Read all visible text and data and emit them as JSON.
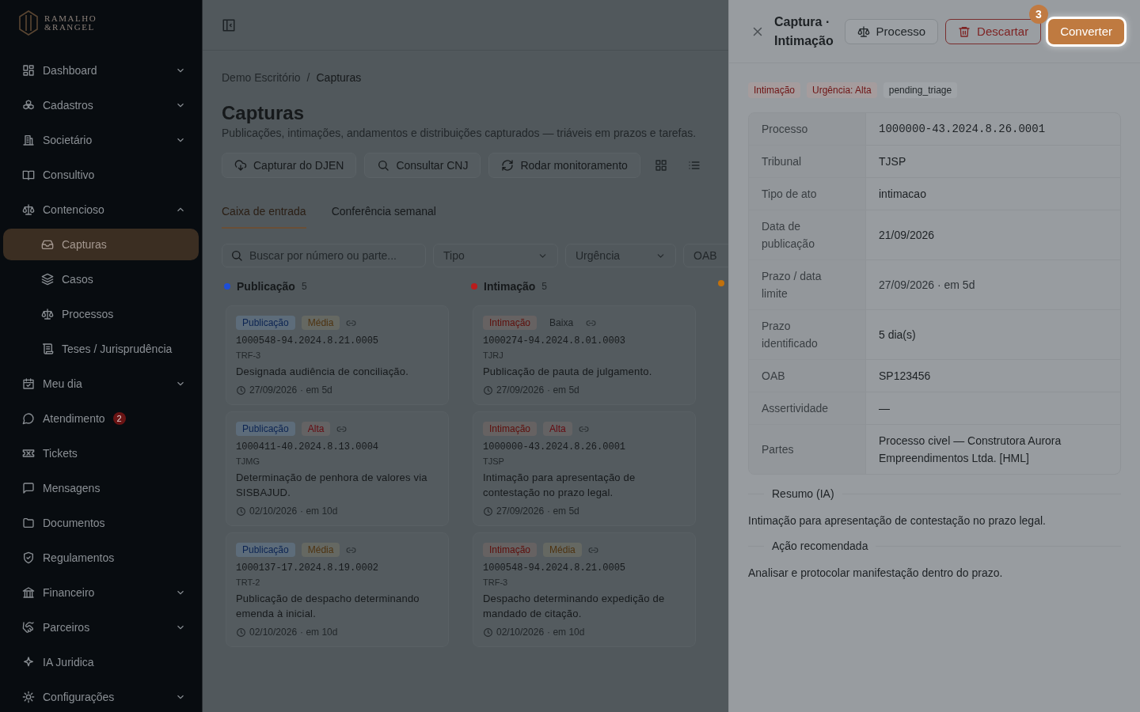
{
  "sidebar": {
    "logo": {
      "line1": "RAMALHO",
      "line2": "&RANGEL"
    },
    "items": [
      {
        "label": "Dashboard",
        "kind": "group",
        "expanded": false,
        "selected": false
      },
      {
        "label": "Cadastros",
        "kind": "group",
        "expanded": false,
        "selected": false
      },
      {
        "label": "Societário",
        "kind": "group",
        "expanded": false,
        "selected": false
      },
      {
        "label": "Consultivo",
        "kind": "link",
        "selected": false
      },
      {
        "label": "Contencioso",
        "kind": "group",
        "expanded": true,
        "selected": false,
        "children": [
          {
            "label": "Capturas",
            "selected": true
          },
          {
            "label": "Casos",
            "selected": false
          },
          {
            "label": "Processos",
            "selected": false
          },
          {
            "label": "Teses / Jurisprudência",
            "selected": false
          }
        ]
      },
      {
        "label": "Meu dia",
        "kind": "group",
        "expanded": false,
        "selected": false
      },
      {
        "label": "Atendimento",
        "kind": "link",
        "selected": false,
        "badge": "2"
      },
      {
        "label": "Tickets",
        "kind": "link",
        "selected": false
      },
      {
        "label": "Mensagens",
        "kind": "link",
        "selected": false
      },
      {
        "label": "Documentos",
        "kind": "link",
        "selected": false
      },
      {
        "label": "Regulamentos",
        "kind": "link",
        "selected": false
      },
      {
        "label": "Financeiro",
        "kind": "group",
        "expanded": false,
        "selected": false
      },
      {
        "label": "Parceiros",
        "kind": "group",
        "expanded": false,
        "selected": false
      },
      {
        "label": "IA Juridica",
        "kind": "link",
        "selected": false
      },
      {
        "label": "Configurações",
        "kind": "group",
        "expanded": false,
        "selected": false
      }
    ]
  },
  "main": {
    "breadcrumb": [
      "Demo Escritório",
      "Capturas"
    ],
    "breadcrumb_separator": "/",
    "title": "Capturas",
    "subtitle": "Publicações, intimações, andamentos e distribuições capturados — triáveis em prazos e tarefas.",
    "actions": [
      "Capturar do DJEN",
      "Consultar CNJ",
      "Rodar monitoramento"
    ],
    "views": [
      {
        "kind": "grid"
      },
      {
        "kind": "list"
      }
    ],
    "tabs": [
      {
        "label": "Caixa de entrada",
        "selected": true
      },
      {
        "label": "Conferência semanal",
        "selected": false
      }
    ],
    "filters": {
      "search": {
        "placeholder": "Buscar por número ou parte..."
      },
      "selects": [
        {
          "placeholder": "Tipo"
        },
        {
          "placeholder": "Urgência"
        },
        {
          "placeholder": "OAB"
        }
      ]
    },
    "columns": [
      {
        "title": "Publicação",
        "count": "5",
        "color": "#1d4ed8",
        "cards": [
          {
            "type": {
              "label": "Publicação",
              "kind": "publication"
            },
            "urgency": {
              "label": "Média",
              "kind": "medium"
            },
            "number": "1000548-94.2024.8.21.0005",
            "court": "TRF-3",
            "text": "Designada audiência de conciliação.",
            "due": "27/09/2026",
            "due_rel": "· em 5d"
          },
          {
            "type": {
              "label": "Publicação",
              "kind": "publication"
            },
            "urgency": {
              "label": "Alta",
              "kind": "high"
            },
            "number": "1000411-40.2024.8.13.0004",
            "court": "TJMG",
            "text": "Determinação de penhora de valores via SISBAJUD.",
            "due": "02/10/2026",
            "due_rel": "· em 10d"
          },
          {
            "type": {
              "label": "Publicação",
              "kind": "publication"
            },
            "urgency": {
              "label": "Média",
              "kind": "medium"
            },
            "number": "1000137-17.2024.8.19.0002",
            "court": "TRT-2",
            "text": "Publicação de despacho determinando emenda à inicial.",
            "due": "02/10/2026",
            "due_rel": "· em 10d"
          }
        ]
      },
      {
        "title": "Intimação",
        "count": "5",
        "color": "#b91c1c",
        "cards": [
          {
            "type": {
              "label": "Intimação",
              "kind": "notice"
            },
            "urgency": {
              "label": "Baixa",
              "kind": "low"
            },
            "number": "1000274-94.2024.8.01.0003",
            "court": "TJRJ",
            "text": "Publicação de pauta de julgamento.",
            "due": "27/09/2026",
            "due_rel": "· em 5d"
          },
          {
            "type": {
              "label": "Intimação",
              "kind": "notice"
            },
            "urgency": {
              "label": "Alta",
              "kind": "high"
            },
            "number": "1000000-43.2024.8.26.0001",
            "court": "TJSP",
            "text": "Intimação para apresentação de contestação no prazo legal.",
            "due": "27/09/2026",
            "due_rel": "· em 5d"
          },
          {
            "type": {
              "label": "Intimação",
              "kind": "notice"
            },
            "urgency": {
              "label": "Média",
              "kind": "medium"
            },
            "number": "1000548-94.2024.8.21.0005",
            "court": "TRF-3",
            "text": "Despacho determinando expedição de mandado de citação.",
            "due": "02/10/2026",
            "due_rel": "· em 10d"
          }
        ]
      },
      {
        "color": "#c2710c"
      }
    ]
  },
  "drawer": {
    "title": "Captura · Intimação",
    "buttons": [
      {
        "label": "Processo",
        "kind": "outline",
        "highlighted": false
      },
      {
        "label": "Descartar",
        "kind": "danger",
        "highlighted": false
      },
      {
        "label": "Converter",
        "kind": "primary",
        "highlighted": true,
        "step": "3"
      }
    ],
    "tags": [
      {
        "label": "Intimação",
        "kind": "red"
      },
      {
        "label": "Urgência: Alta",
        "kind": "red"
      },
      {
        "label": "pending_triage",
        "kind": "neutral"
      }
    ],
    "details": [
      {
        "label": "Processo",
        "value": "1000000-43.2024.8.26.0001",
        "kind": "mono"
      },
      {
        "label": "Tribunal",
        "value": "TJSP",
        "kind": "text"
      },
      {
        "label": "Tipo de ato",
        "value": "intimacao",
        "kind": "text"
      },
      {
        "label": "Data de publicação",
        "value": "21/09/2026",
        "kind": "text"
      },
      {
        "label": "Prazo / data limite",
        "value": "27/09/2026 · em 5d",
        "kind": "muted"
      },
      {
        "label": "Prazo identificado",
        "value": "5 dia(s)",
        "kind": "text"
      },
      {
        "label": "OAB",
        "value": "SP123456",
        "kind": "text"
      },
      {
        "label": "Assertividade",
        "value": "—",
        "kind": "text"
      },
      {
        "label": "Partes",
        "value": "Processo civel — Construtora Aurora Empreendimentos Ltda. [HML]",
        "kind": "text"
      }
    ],
    "sections": [
      {
        "heading": "Resumo (IA)",
        "text": "Intimação para apresentação de contestação no prazo legal."
      },
      {
        "heading": "Ação recomendada",
        "text": "Analisar e protocolar manifestação dentro do prazo."
      }
    ]
  }
}
